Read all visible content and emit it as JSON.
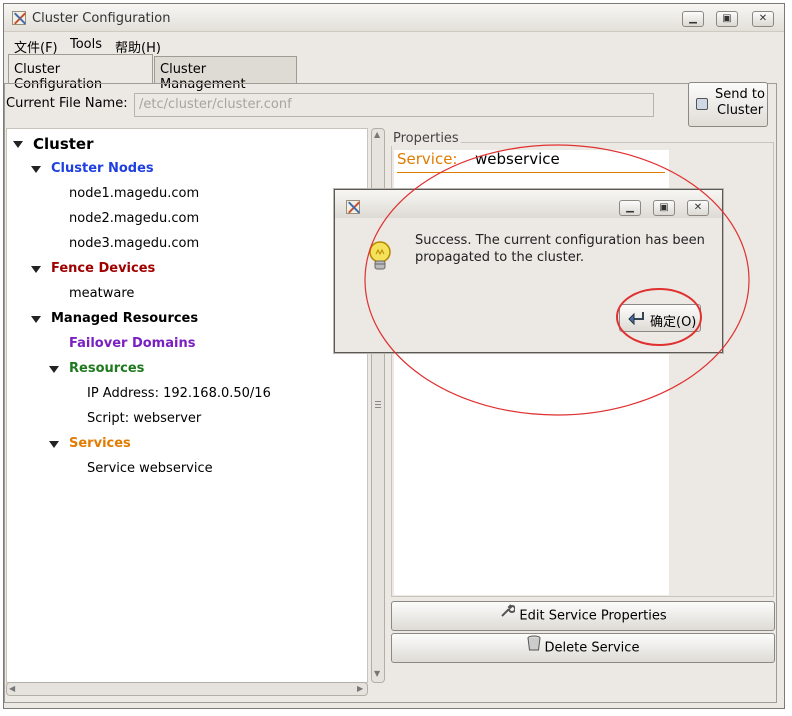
{
  "window": {
    "title": "Cluster Configuration"
  },
  "menu": [
    {
      "label": "文件(F)"
    },
    {
      "label": "Tools"
    },
    {
      "label": "帮助(H)"
    }
  ],
  "tabs": [
    {
      "label": "Cluster Configuration",
      "active": true
    },
    {
      "label": "Cluster Management",
      "active": false
    }
  ],
  "file": {
    "label": "Current File Name:",
    "value": "/etc/cluster/cluster.conf"
  },
  "send_button": {
    "line1": "Send to",
    "line2": "Cluster"
  },
  "tree": {
    "root": "Cluster",
    "nodes_header": "Cluster Nodes",
    "nodes": [
      "node1.magedu.com",
      "node2.magedu.com",
      "node3.magedu.com"
    ],
    "fence_header": "Fence Devices",
    "fence_items": [
      "meatware"
    ],
    "managed_header": "Managed Resources",
    "failover": "Failover Domains",
    "resources_header": "Resources",
    "resources": [
      "IP Address:  192.168.0.50/16",
      "Script:  webserver"
    ],
    "services_header": "Services",
    "services": [
      "Service webservice"
    ]
  },
  "colors": {
    "nodes": "#1f3fe0",
    "fence": "#a00000",
    "failover": "#7a1fc0",
    "resources": "#1f7a1f",
    "services": "#e07c00",
    "annotation": "#e03030"
  },
  "properties": {
    "caption": "Properties",
    "service_label": "Service:",
    "service_value": "webservice"
  },
  "buttons": {
    "edit": "Edit Service Properties",
    "delete": "Delete Service"
  },
  "dialog": {
    "message": "Success. The current configuration has been propagated to the cluster.",
    "ok": "确定(O)",
    "icon": "lightbulb-icon"
  }
}
